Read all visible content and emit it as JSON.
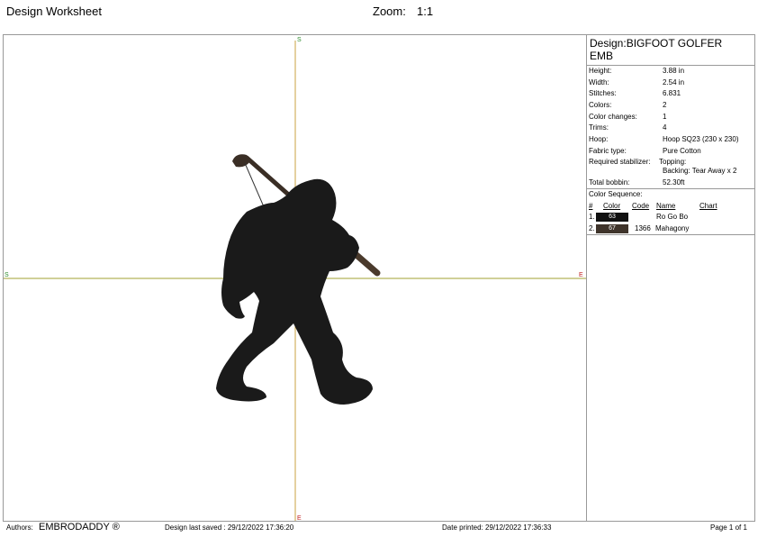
{
  "header": {
    "title": "Design Worksheet",
    "zoom_label": "Zoom:",
    "zoom_value": "1:1"
  },
  "canvas": {
    "axis_start": "S",
    "axis_end": "E",
    "colors": {
      "vertical_axis": "#c8a040",
      "horizontal_axis": "#a0a030",
      "silhouette": "#1a1a1a",
      "club_grip": "#4a3a2c"
    }
  },
  "info": {
    "design_name": "Design:BIGFOOT GOLFER EMB",
    "props": [
      {
        "label": "Height:",
        "value": "3.88 in"
      },
      {
        "label": "Width:",
        "value": "2.54 in"
      },
      {
        "label": "Stitches:",
        "value": "6.831"
      },
      {
        "label": "Colors:",
        "value": "2"
      },
      {
        "label": "Color changes:",
        "value": "1"
      },
      {
        "label": "Trims:",
        "value": "4"
      },
      {
        "label": "Hoop:",
        "value": "Hoop SQ23 (230 x 230)"
      },
      {
        "label": "Fabric type:",
        "value": "Pure Cotton"
      },
      {
        "label": "Required stabilizer:",
        "value": "Topping:"
      },
      {
        "label": "",
        "value": "Backing: Tear Away x 2"
      },
      {
        "label": "Total bobbin:",
        "value": "52.30ft"
      }
    ],
    "sequence_title": "Color Sequence:",
    "columns": {
      "num": "#",
      "color": "Color",
      "code": "Code",
      "name": "Name",
      "chart": "Chart"
    },
    "sequence": [
      {
        "num": "1.",
        "swatch": "63",
        "code": "",
        "name": "Ro Go Bo",
        "hex": "#111111"
      },
      {
        "num": "2.",
        "swatch": "67",
        "code": "1366",
        "name": "Mahagony",
        "hex": "#3f342b"
      }
    ]
  },
  "footer": {
    "authors_label": "Authors:",
    "authors": "EMBRODADDY ®",
    "saved": "Design last saved : 29/12/2022 17:36:20",
    "printed": "Date printed: 29/12/2022 17:36:33",
    "page": "Page 1 of 1"
  }
}
